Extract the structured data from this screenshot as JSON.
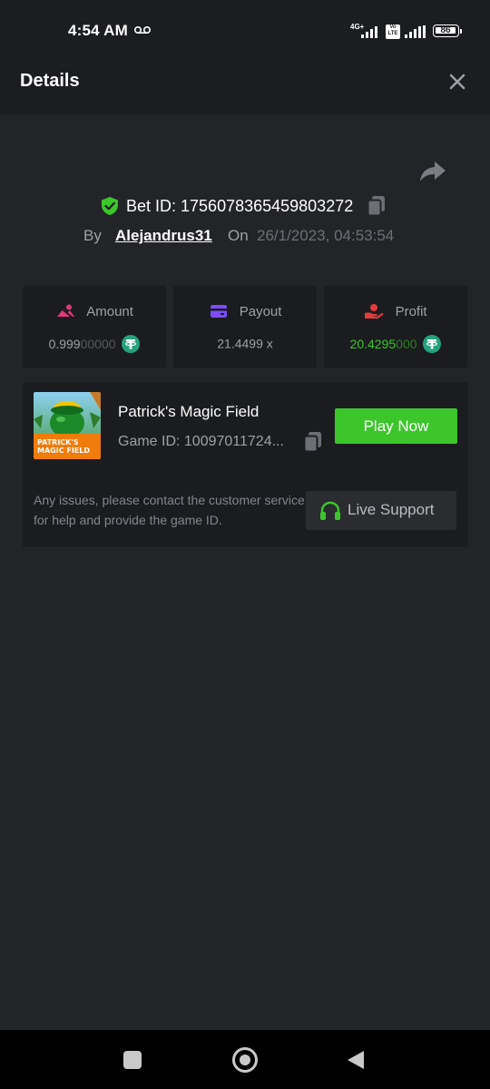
{
  "status_bar": {
    "time": "4:54 AM",
    "network_type": "4G+",
    "volte_label": "Vo LTE",
    "battery": "86"
  },
  "header": {
    "title": "Details"
  },
  "bet": {
    "id_label": "Bet ID: 1756078365459803272",
    "by_label": "By",
    "username": "Alejandrus31",
    "on_label": "On",
    "date": "26/1/2023, 04:53:54"
  },
  "stats": {
    "amount": {
      "label": "Amount",
      "value_main": "0.999",
      "value_dim": "00000",
      "currency_icon": "tether-icon",
      "icon_color": "#e0397a"
    },
    "payout": {
      "label": "Payout",
      "value": "21.4499 x",
      "icon_color": "#7b4dff"
    },
    "profit": {
      "label": "Profit",
      "value_main": "20.4295",
      "value_dim": "000",
      "currency_icon": "tether-icon",
      "icon_color": "#e23b3b",
      "value_color": "#3dc52c"
    }
  },
  "game": {
    "thumb_title_line1": "PATRICK'S",
    "thumb_title_line2": "MAGIC FIELD",
    "name": "Patrick's Magic Field",
    "id_label": "Game ID: 10097011724...",
    "play_label": "Play Now",
    "support_text": "Any issues, please contact the customer service for help and provide the game ID.",
    "live_support_label": "Live Support"
  },
  "colors": {
    "accent_green": "#3dc52c",
    "background": "#232427",
    "card": "#1b1c1f",
    "tether": "#26a17b"
  }
}
